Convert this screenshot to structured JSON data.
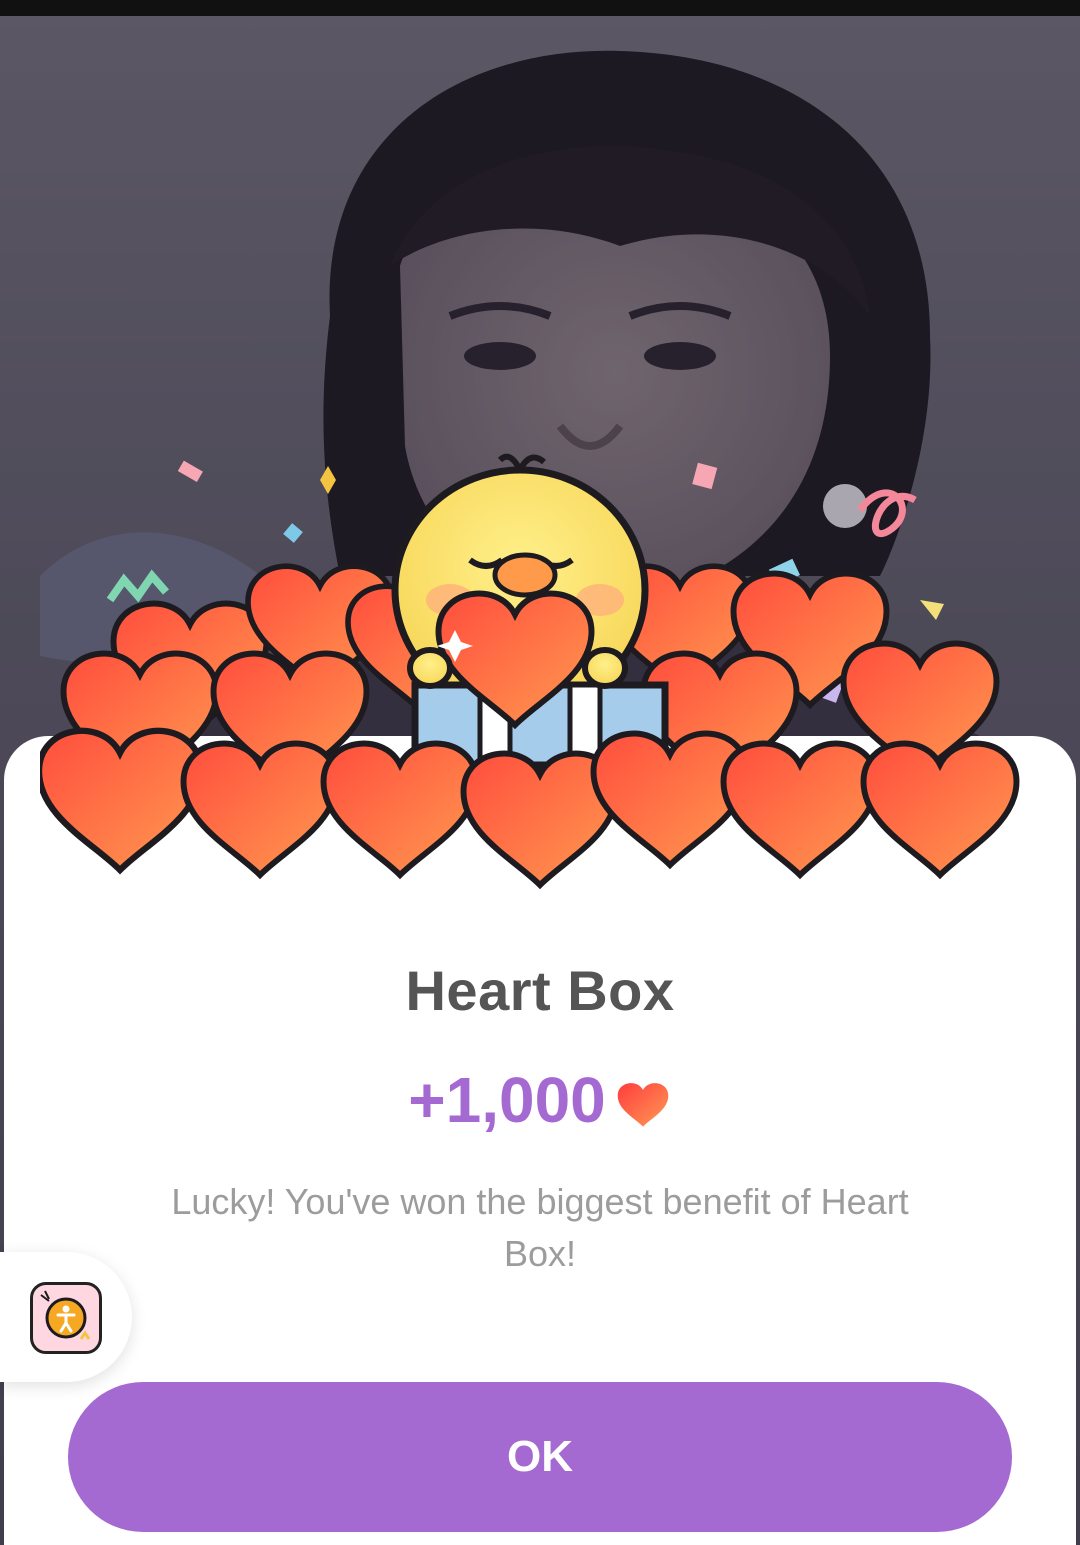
{
  "dialog": {
    "title": "Heart Box",
    "amount": "+1,000",
    "message": "Lucky! You've won the biggest benefit of Heart Box!",
    "ok_label": "OK"
  },
  "icons": {
    "reward": "heart-icon",
    "widget": "accessibility-app-icon"
  },
  "colors": {
    "accent": "#a56ad1",
    "heart": "#ff5a3c",
    "text": "#555555",
    "muted": "#9c9c9c"
  }
}
